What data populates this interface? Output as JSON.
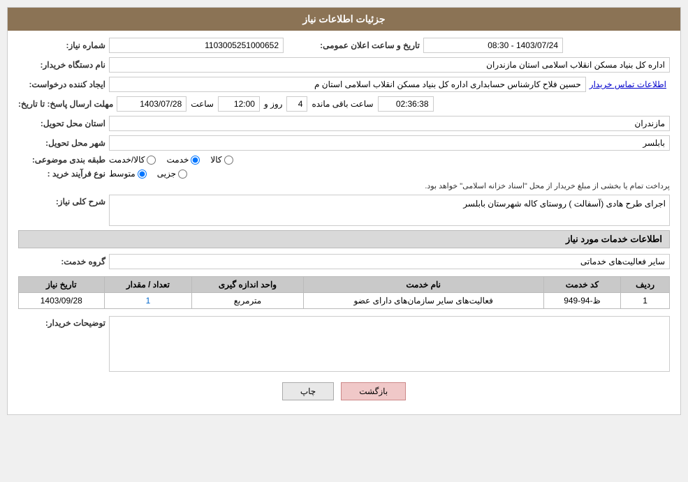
{
  "page": {
    "title": "جزئیات اطلاعات نیاز"
  },
  "header": {
    "label": "شماره نیاز:",
    "id_value": "1103005251000652",
    "date_label": "تاریخ و ساعت اعلان عمومی:",
    "date_value": "1403/07/24 - 08:30"
  },
  "fields": {
    "buyer_org_label": "نام دستگاه خریدار:",
    "buyer_org_value": "اداره کل بنیاد مسکن انقلاب اسلامی استان مازندران",
    "creator_label": "ایجاد کننده درخواست:",
    "creator_value": "حسین فلاح کارشناس حسابداری اداره کل بنیاد مسکن انقلاب اسلامی استان م",
    "creator_link": "اطلاعات تماس خریدار",
    "deadline_label": "مهلت ارسال پاسخ: تا تاریخ:",
    "deadline_date": "1403/07/28",
    "deadline_time_label": "ساعت",
    "deadline_time": "12:00",
    "deadline_days_label": "روز و",
    "deadline_days": "4",
    "deadline_remaining_label": "ساعت باقی مانده",
    "deadline_remaining": "02:36:38",
    "province_label": "استان محل تحویل:",
    "province_value": "مازندران",
    "city_label": "شهر محل تحویل:",
    "city_value": "بابلسر",
    "category_label": "طبقه بندی موضوعی:",
    "category_options": [
      "کالا",
      "خدمت",
      "کالا/خدمت"
    ],
    "category_selected": "خدمت",
    "purchase_type_label": "نوع فرآیند خرید :",
    "purchase_type_options": [
      "جزیی",
      "متوسط"
    ],
    "purchase_type_selected": "متوسط",
    "purchase_type_note": "پرداخت تمام یا بخشی از مبلغ خریدار از محل \"اسناد خزانه اسلامی\" خواهد بود.",
    "description_label": "شرح کلی نیاز:",
    "description_value": "اجرای  طرح هادی (آسفالت ) روستای کاله شهرستان بابلسر"
  },
  "services_section": {
    "title": "اطلاعات خدمات مورد نیاز",
    "service_group_label": "گروه خدمت:",
    "service_group_value": "سایر فعالیت‌های خدماتی",
    "table": {
      "columns": [
        "ردیف",
        "کد خدمت",
        "نام خدمت",
        "واحد اندازه گیری",
        "تعداد / مقدار",
        "تاریخ نیاز"
      ],
      "rows": [
        {
          "row": "1",
          "code": "ظ-94-949",
          "name": "فعالیت‌های سایر سازمان‌های دارای عضو",
          "unit": "مترمربع",
          "quantity": "1",
          "date": "1403/09/28"
        }
      ]
    }
  },
  "buyer_notes_label": "توضیحات خریدار:",
  "buyer_notes_value": "",
  "buttons": {
    "print": "چاپ",
    "back": "بازگشت"
  }
}
